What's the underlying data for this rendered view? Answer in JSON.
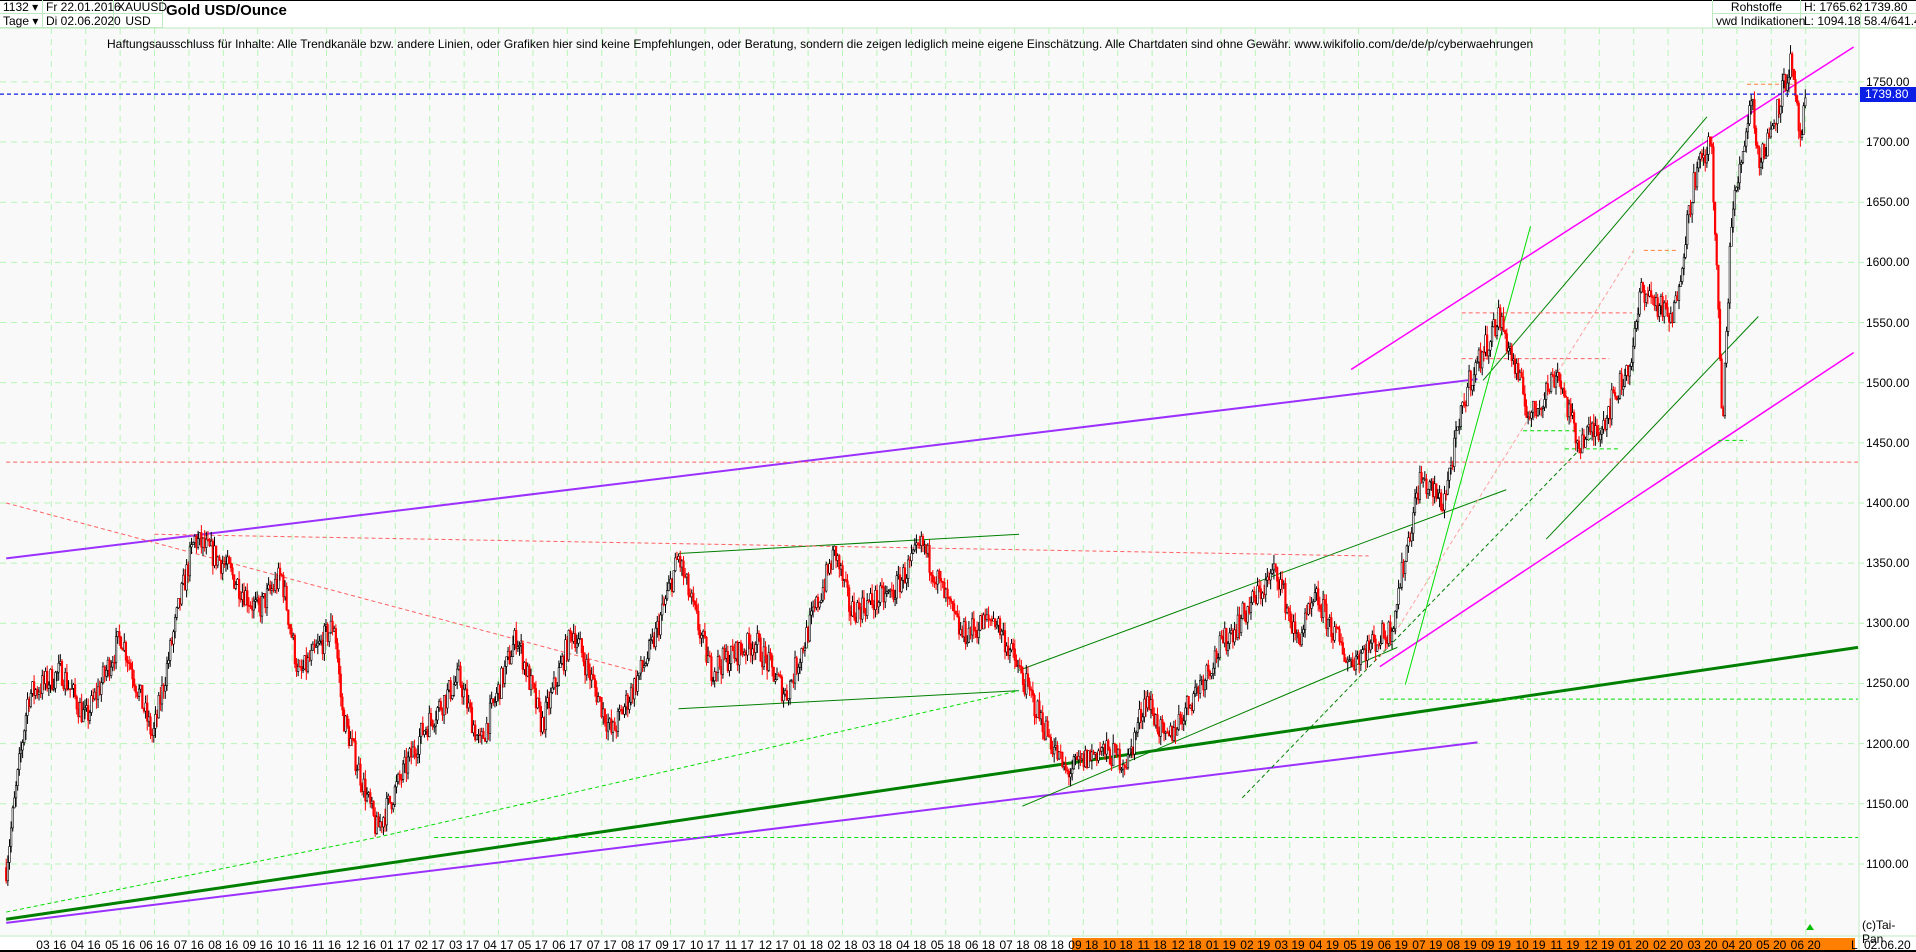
{
  "header": {
    "period_count": "1132",
    "interval": "Tage",
    "start_date": "Fr 22.01.2016",
    "end_date": "Di 02.06.2020",
    "symbol": "XAUUSD",
    "currency": "USD",
    "title": "Gold USD/Ounce",
    "category": "Rohstoffe",
    "source": "vwd Indikationen",
    "high": "H: 1765.62",
    "low": "L: 1094.18",
    "last": "1739.80",
    "range_info": "58.4/641.4"
  },
  "disclaimer": "Haftungsausschluss für Inhalte: Alle Trendkanäle bzw. andere Linien, oder Grafiken hier sind keine Empfehlungen, oder Beratung, sondern die zeigen lediglich meine eigene Einschätzung. Alle Chartdaten sind ohne Gewähr.  www.wikifolio.com/de/de/p/cyberwaehrungen",
  "footer": {
    "copyright": "(c)Tai-Pan",
    "scale_mode": "L",
    "last_date": "02.06.20"
  },
  "colors": {
    "up_candle": "#000000",
    "down_candle": "#ff0000",
    "last_price_line": "#0a1ee6",
    "grid": "#b6f5b6",
    "x_axis_highlight": "#ff8000"
  },
  "chart_data": {
    "type": "candlestick",
    "title": "Gold USD/Ounce",
    "ylim": [
      1080,
      1790
    ],
    "grid": true,
    "y_ticks": [
      "1100.00",
      "1150.00",
      "1200.00",
      "1250.00",
      "1300.00",
      "1350.00",
      "1400.00",
      "1450.00",
      "1500.00",
      "1550.00",
      "1600.00",
      "1650.00",
      "1700.00",
      "1750.00"
    ],
    "x_ticks": [
      "03 16",
      "04 16",
      "05 16",
      "06 16",
      "07 16",
      "08 16",
      "09 16",
      "10 16",
      "11 16",
      "12 16",
      "01 17",
      "02 17",
      "03 17",
      "04 17",
      "05 17",
      "06 17",
      "07 17",
      "08 17",
      "09 17",
      "10 17",
      "11 17",
      "12 17",
      "01 18",
      "02 18",
      "03 18",
      "04 18",
      "05 18",
      "06 18",
      "07 18",
      "08 18",
      "09 18",
      "10 18",
      "11 18",
      "12 18",
      "01 19",
      "02 19",
      "03 19",
      "04 19",
      "05 19",
      "06 19",
      "07 19",
      "08 19",
      "09 19",
      "10 19",
      "11 19",
      "12 19",
      "01 20",
      "02 20",
      "03 20",
      "04 20",
      "05 20",
      "06 20"
    ],
    "last_price": 1739.8,
    "price_path": [
      [
        "2016-01-22",
        1097
      ],
      [
        "2016-02-11",
        1240
      ],
      [
        "2016-03-10",
        1260
      ],
      [
        "2016-04-01",
        1220
      ],
      [
        "2016-05-02",
        1290
      ],
      [
        "2016-05-30",
        1205
      ],
      [
        "2016-06-24",
        1320
      ],
      [
        "2016-07-06",
        1370
      ],
      [
        "2016-08-01",
        1350
      ],
      [
        "2016-09-01",
        1310
      ],
      [
        "2016-09-22",
        1340
      ],
      [
        "2016-10-07",
        1255
      ],
      [
        "2016-11-08",
        1300
      ],
      [
        "2016-11-15",
        1225
      ],
      [
        "2016-12-15",
        1128
      ],
      [
        "2017-01-25",
        1210
      ],
      [
        "2017-02-27",
        1255
      ],
      [
        "2017-03-15",
        1198
      ],
      [
        "2017-04-17",
        1290
      ],
      [
        "2017-05-09",
        1215
      ],
      [
        "2017-06-06",
        1295
      ],
      [
        "2017-07-10",
        1208
      ],
      [
        "2017-08-15",
        1280
      ],
      [
        "2017-09-08",
        1355
      ],
      [
        "2017-10-06",
        1262
      ],
      [
        "2017-11-15",
        1285
      ],
      [
        "2017-12-12",
        1240
      ],
      [
        "2018-01-25",
        1360
      ],
      [
        "2018-02-08",
        1310
      ],
      [
        "2018-03-15",
        1325
      ],
      [
        "2018-04-11",
        1365
      ],
      [
        "2018-05-15",
        1290
      ],
      [
        "2018-06-14",
        1305
      ],
      [
        "2018-07-15",
        1240
      ],
      [
        "2018-08-16",
        1175
      ],
      [
        "2018-09-15",
        1195
      ],
      [
        "2018-10-10",
        1185
      ],
      [
        "2018-10-26",
        1240
      ],
      [
        "2018-11-13",
        1200
      ],
      [
        "2018-12-31",
        1280
      ],
      [
        "2019-02-20",
        1345
      ],
      [
        "2019-03-07",
        1285
      ],
      [
        "2019-03-25",
        1320
      ],
      [
        "2019-04-23",
        1268
      ],
      [
        "2019-05-30",
        1295
      ],
      [
        "2019-06-25",
        1420
      ],
      [
        "2019-07-15",
        1400
      ],
      [
        "2019-08-07",
        1500
      ],
      [
        "2019-09-04",
        1555
      ],
      [
        "2019-10-01",
        1470
      ],
      [
        "2019-10-25",
        1510
      ],
      [
        "2019-11-12",
        1450
      ],
      [
        "2019-12-03",
        1465
      ],
      [
        "2019-12-30",
        1520
      ],
      [
        "2020-01-08",
        1580
      ],
      [
        "2020-02-05",
        1550
      ],
      [
        "2020-02-24",
        1670
      ],
      [
        "2020-03-09",
        1700
      ],
      [
        "2020-03-19",
        1460
      ],
      [
        "2020-03-26",
        1630
      ],
      [
        "2020-04-14",
        1740
      ],
      [
        "2020-04-21",
        1680
      ],
      [
        "2020-05-18",
        1765
      ],
      [
        "2020-05-27",
        1700
      ],
      [
        "2020-06-02",
        1739.8
      ]
    ],
    "trendlines": [
      {
        "color": "#9b30ff",
        "width": 2,
        "style": "solid",
        "from": [
          "2016-01-22",
          1354
        ],
        "to": [
          "2019-08-15",
          1503
        ]
      },
      {
        "color": "#9b30ff",
        "width": 2,
        "style": "solid",
        "from": [
          "2016-01-22",
          1051
        ],
        "to": [
          "2019-08-15",
          1201
        ]
      },
      {
        "color": "#008000",
        "width": 3,
        "style": "solid",
        "from": [
          "2016-01-22",
          1054
        ],
        "to": [
          "2020-09-05",
          1280
        ]
      },
      {
        "color": "#ff00ff",
        "width": 1.5,
        "style": "solid",
        "from": [
          "2019-04-25",
          1511
        ],
        "to": [
          "2020-07-13",
          1779
        ]
      },
      {
        "color": "#ff00ff",
        "width": 1.5,
        "style": "solid",
        "from": [
          "2019-05-20",
          1264
        ],
        "to": [
          "2020-07-13",
          1525
        ]
      },
      {
        "color": "#008000",
        "width": 1,
        "style": "solid",
        "from": [
          "2017-09-08",
          1358
        ],
        "to": [
          "2018-07-05",
          1374
        ]
      },
      {
        "color": "#008000",
        "width": 1,
        "style": "solid",
        "from": [
          "2017-09-08",
          1229
        ],
        "to": [
          "2018-07-05",
          1244
        ]
      },
      {
        "color": "#008000",
        "width": 1,
        "style": "solid",
        "from": [
          "2018-07-05",
          1261
        ],
        "to": [
          "2019-09-10",
          1411
        ]
      },
      {
        "color": "#008000",
        "width": 1,
        "style": "solid",
        "from": [
          "2018-07-08",
          1148
        ],
        "to": [
          "2019-06-05",
          1280
        ]
      },
      {
        "color": "#008000",
        "width": 1,
        "style": "solid",
        "from": [
          "2019-08-20",
          1502
        ],
        "to": [
          "2020-03-05",
          1721
        ]
      },
      {
        "color": "#008000",
        "width": 1,
        "style": "solid",
        "from": [
          "2019-10-15",
          1370
        ],
        "to": [
          "2020-04-20",
          1555
        ]
      },
      {
        "color": "#00dd00",
        "width": 1,
        "style": "solid",
        "from": [
          "2019-06-12",
          1249
        ],
        "to": [
          "2019-10-01",
          1630
        ]
      },
      {
        "color": "#008000",
        "width": 1,
        "style": "dashed",
        "from": [
          "2019-01-20",
          1155
        ],
        "to": [
          "2019-12-10",
          1470
        ]
      },
      {
        "color": "#00dd00",
        "width": 1,
        "style": "dashed",
        "from": [
          "2016-12-15",
          1122
        ],
        "to": [
          "2018-07-05",
          1244
        ]
      },
      {
        "color": "#00dd00",
        "width": 1,
        "style": "dashed",
        "from": [
          "2016-01-22",
          1060
        ],
        "to": [
          "2016-12-15",
          1122
        ]
      },
      {
        "color": "#00dd00",
        "width": 1,
        "style": "dashed",
        "from": [
          "2017-02-05",
          1122
        ],
        "to": [
          "2020-09-05",
          1122
        ]
      },
      {
        "color": "#00dd00",
        "width": 1,
        "style": "dashed",
        "from": [
          "2019-05-20",
          1237
        ],
        "to": [
          "2020-09-05",
          1237
        ]
      },
      {
        "color": "#ff6060",
        "width": 1,
        "style": "dashed",
        "from": [
          "2016-01-22",
          1434
        ],
        "to": [
          "2020-09-05",
          1434
        ]
      },
      {
        "color": "#ff6060",
        "width": 1,
        "style": "dashed",
        "from": [
          "2016-01-22",
          1400
        ],
        "to": [
          "2017-08-01",
          1260
        ]
      },
      {
        "color": "#ff6060",
        "width": 1,
        "style": "dashed",
        "from": [
          "2016-06-01",
          1374
        ],
        "to": [
          "2019-05-10",
          1356
        ]
      },
      {
        "color": "#ffa0a0",
        "width": 1,
        "style": "dashed",
        "from": [
          "2019-05-20",
          1272
        ],
        "to": [
          "2020-01-01",
          1610
        ]
      },
      {
        "color": "#ff6060",
        "width": 1,
        "style": "dashed",
        "from": [
          "2019-08-01",
          1558
        ],
        "to": [
          "2019-12-30",
          1558
        ]
      },
      {
        "color": "#ff6060",
        "width": 1,
        "style": "dashed",
        "from": [
          "2019-08-01",
          1520
        ],
        "to": [
          "2019-12-10",
          1520
        ]
      },
      {
        "color": "#ff8040",
        "width": 1,
        "style": "dashed",
        "from": [
          "2020-01-10",
          1610
        ],
        "to": [
          "2020-02-10",
          1610
        ]
      },
      {
        "color": "#ff8040",
        "width": 1,
        "style": "dashed",
        "from": [
          "2020-04-10",
          1748
        ],
        "to": [
          "2020-05-20",
          1748
        ]
      },
      {
        "color": "#00dd00",
        "width": 1,
        "style": "dashed",
        "from": [
          "2019-09-25",
          1460
        ],
        "to": [
          "2019-11-15",
          1460
        ]
      },
      {
        "color": "#00dd00",
        "width": 1,
        "style": "dashed",
        "from": [
          "2020-03-15",
          1452
        ],
        "to": [
          "2020-04-10",
          1452
        ]
      },
      {
        "color": "#00dd00",
        "width": 1,
        "style": "dashed",
        "from": [
          "2019-11-01",
          1445
        ],
        "to": [
          "2019-12-20",
          1445
        ]
      }
    ]
  }
}
